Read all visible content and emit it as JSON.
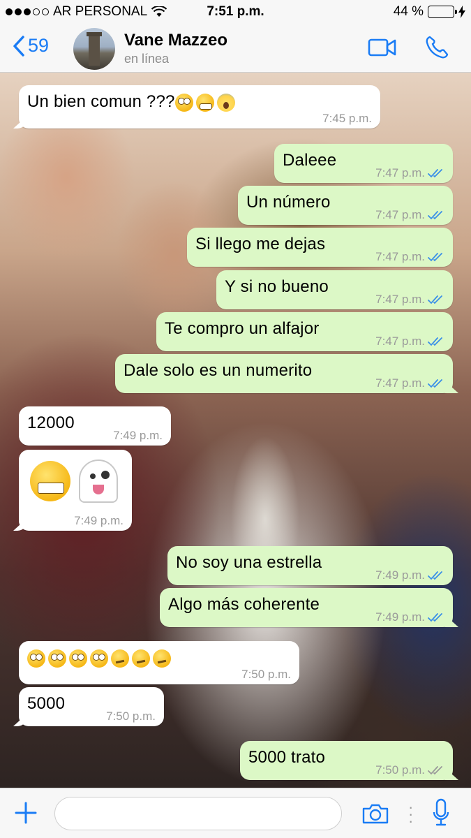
{
  "status_bar": {
    "carrier": "AR PERSONAL",
    "time": "7:51 p.m.",
    "battery": "44 %",
    "battery_level": 0.44
  },
  "header": {
    "back_count": "59",
    "contact_name": "Vane Mazzeo",
    "contact_status": "en línea"
  },
  "messages": [
    {
      "dir": "in",
      "text": "Un bien comun ???",
      "emojis": [
        "eyes",
        "grin",
        "scream"
      ],
      "time": "7:45 p.m."
    },
    {
      "dir": "out",
      "text": "Daleee",
      "time": "7:47 p.m."
    },
    {
      "dir": "out",
      "text": "Un número",
      "time": "7:47 p.m."
    },
    {
      "dir": "out",
      "text": "Si llego me dejas",
      "time": "7:47 p.m."
    },
    {
      "dir": "out",
      "text": "Y si no bueno",
      "time": "7:47 p.m."
    },
    {
      "dir": "out",
      "text": "Te compro un alfajor",
      "time": "7:47 p.m."
    },
    {
      "dir": "out",
      "text": "Dale solo es un numerito",
      "time": "7:47 p.m."
    },
    {
      "dir": "in",
      "text": "12000",
      "time": "7:49 p.m."
    },
    {
      "dir": "in",
      "text": "",
      "emojis": [
        "grin",
        "ghost"
      ],
      "time": "7:49 p.m."
    },
    {
      "dir": "out",
      "text": "No soy una estrella",
      "time": "7:49 p.m."
    },
    {
      "dir": "out",
      "text": "Algo más coherente",
      "time": "7:49 p.m."
    },
    {
      "dir": "in",
      "text": "",
      "emojis": [
        "eyes",
        "eyes",
        "eyes",
        "eyes",
        "think",
        "think",
        "think"
      ],
      "time": "7:50 p.m."
    },
    {
      "dir": "in",
      "text": "5000",
      "time": "7:50 p.m."
    },
    {
      "dir": "out",
      "text": "5000 trato",
      "time": "7:50 p.m.",
      "read": false
    }
  ],
  "input": {
    "placeholder": ""
  },
  "colors": {
    "accent": "#1a7cf5",
    "outgoing_bubble": "#dcf8c6",
    "incoming_bubble": "#ffffff",
    "read_ticks": "#3a8fe8",
    "unread_ticks": "#9a9a9a"
  },
  "icons": {
    "back": "chevron-left-icon",
    "video": "video-camera-icon",
    "call": "phone-icon",
    "plus": "plus-icon",
    "camera": "camera-icon",
    "mic": "microphone-icon",
    "wifi": "wifi-icon",
    "charging": "bolt-icon"
  }
}
